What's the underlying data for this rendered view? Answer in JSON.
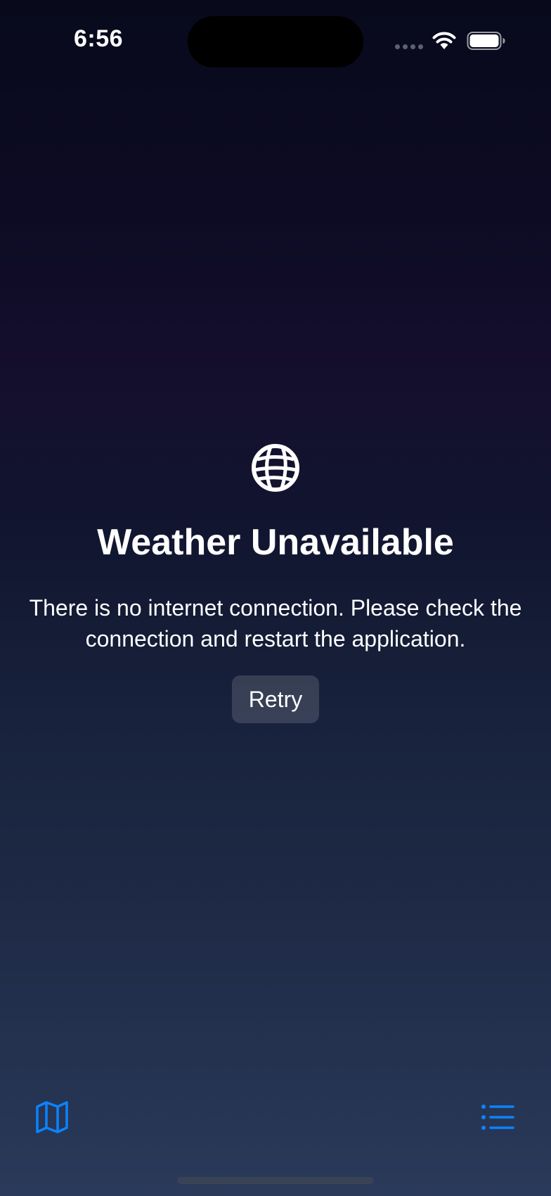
{
  "status_bar": {
    "time": "6:56"
  },
  "error": {
    "icon": "globe-icon",
    "title": "Weather Unavailable",
    "message": "There is no internet connection. Please check the connection and restart the application.",
    "retry_label": "Retry"
  },
  "toolbar": {
    "left_icon": "map-icon",
    "right_icon": "list-icon"
  },
  "colors": {
    "accent": "#0a84ff",
    "background_top": "#080a1c",
    "background_bottom": "#2a3a5a",
    "text": "#ffffff"
  }
}
